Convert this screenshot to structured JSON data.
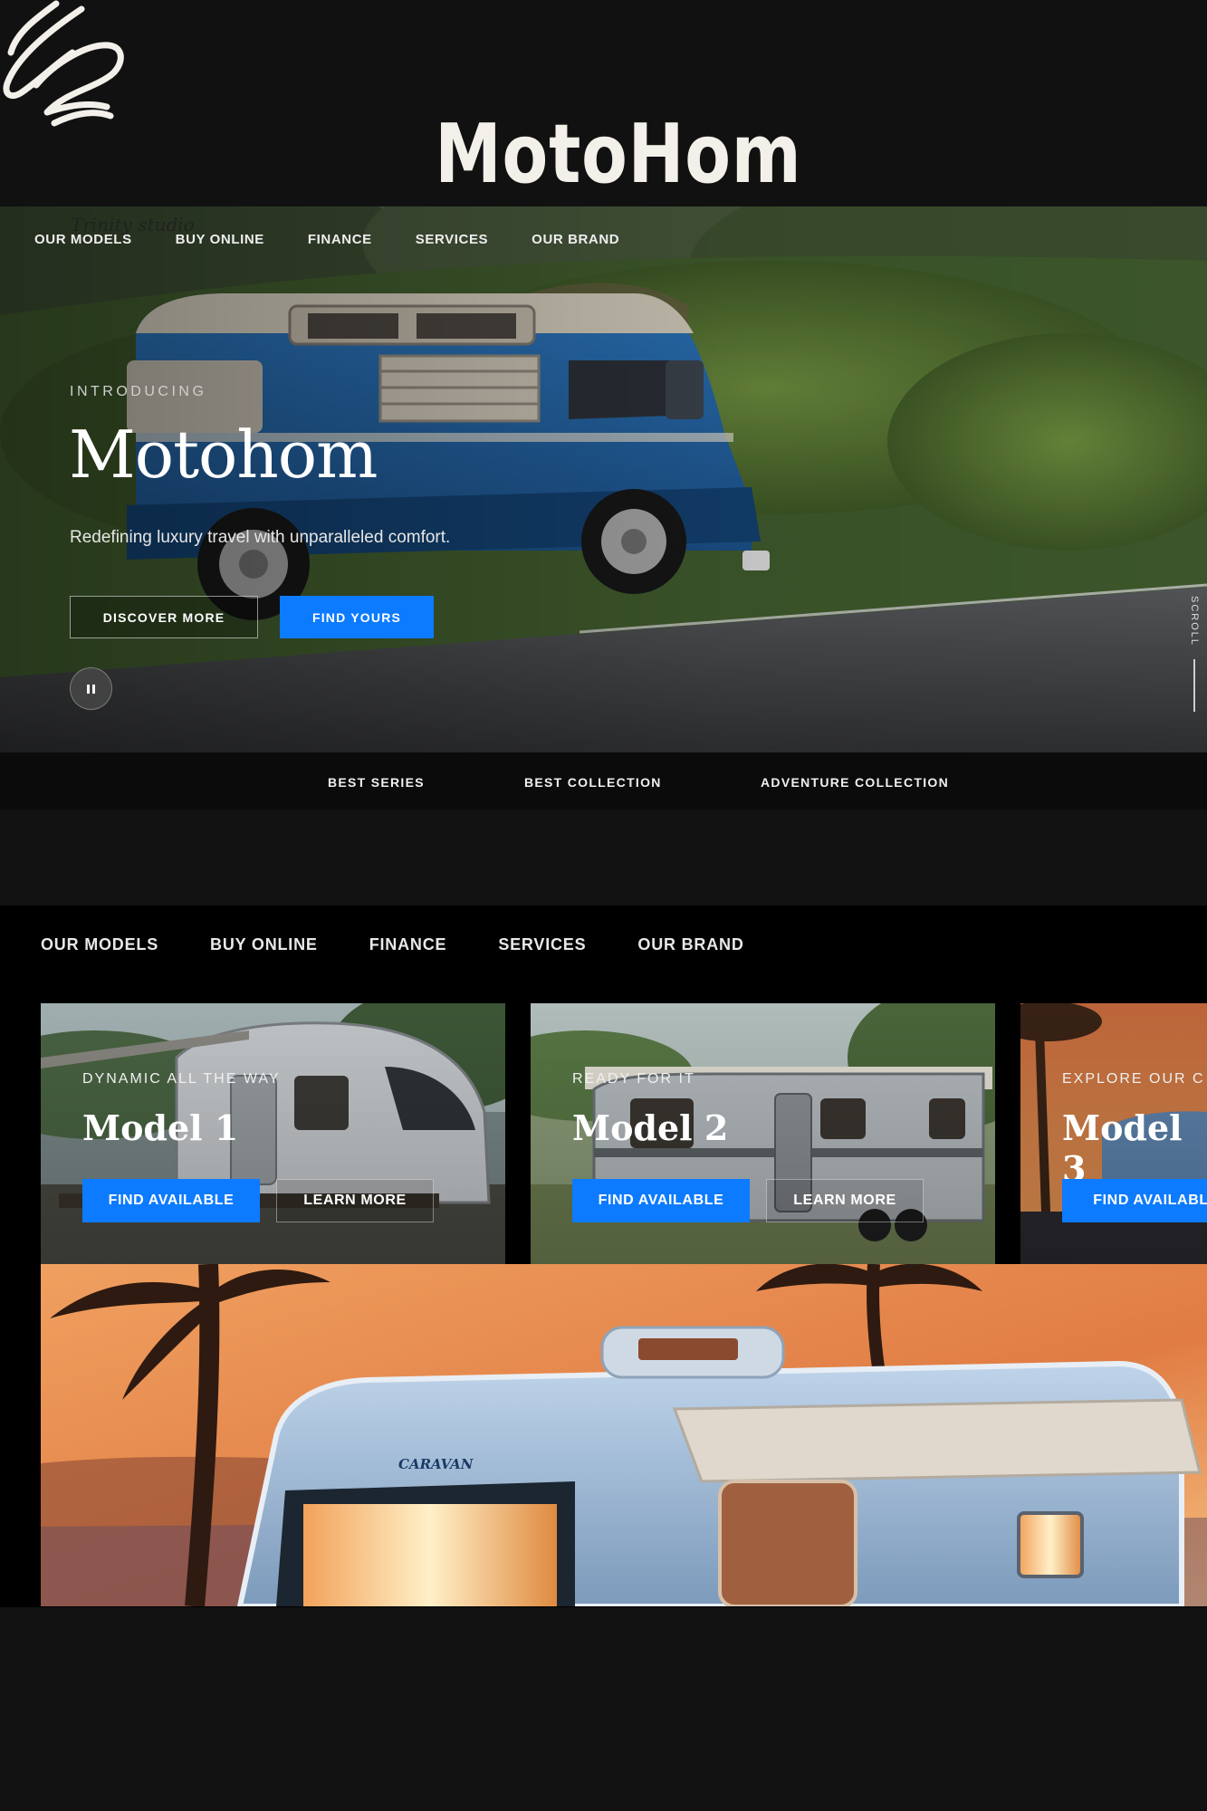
{
  "brand": {
    "title": "MotoHom",
    "studio_mark": "Trinity studio"
  },
  "hero": {
    "nav": [
      "OUR MODELS",
      "BUY ONLINE",
      "FINANCE",
      "SERVICES",
      "OUR BRAND"
    ],
    "eyebrow": "INTRODUCING",
    "title": "Motohom",
    "subtitle": "Redefining luxury travel with unparalleled comfort.",
    "btn_discover": "DISCOVER MORE",
    "btn_find": "FIND YOURS",
    "scroll_label": "SCROLL"
  },
  "collections": [
    "BEST SERIES",
    "BEST COLLECTION",
    "ADVENTURE COLLECTION"
  ],
  "models": {
    "nav": [
      "OUR MODELS",
      "BUY ONLINE",
      "FINANCE",
      "SERVICES",
      "OUR BRAND"
    ],
    "cards": [
      {
        "eyebrow": "DYNAMIC ALL THE WAY",
        "title": "Model 1",
        "btn_primary": "FIND AVAILABLE",
        "btn_secondary": "LEARN MORE"
      },
      {
        "eyebrow": "READY FOR IT",
        "title": "Model 2",
        "btn_primary": "FIND AVAILABLE",
        "btn_secondary": "LEARN MORE"
      },
      {
        "eyebrow": "EXPLORE OUR C",
        "title": "Model 3",
        "btn_primary": "FIND AVAILABL"
      }
    ],
    "banner_badge": "CARAVAN"
  },
  "colors": {
    "accent": "#0d7bff",
    "background": "#121212",
    "header": "#111111"
  },
  "icons": [
    "scribble-logo-icon",
    "pause-icon"
  ]
}
